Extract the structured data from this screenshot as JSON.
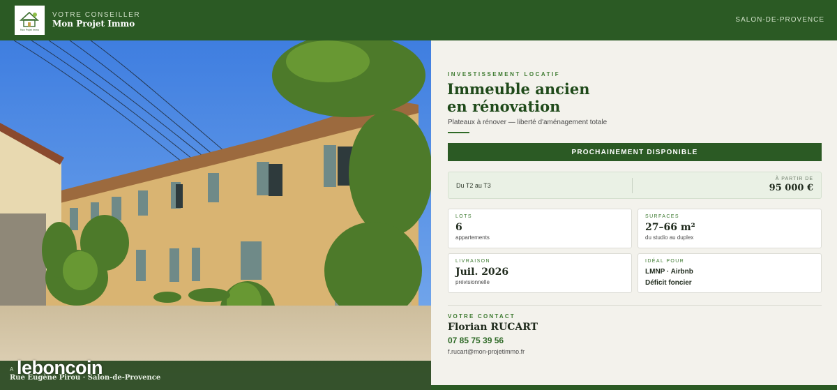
{
  "header": {
    "kicker": "VOTRE CONSEILLER",
    "brand": "Mon Projet Immo",
    "city": "SALON-DE-PROVENCE",
    "logo_text": "Mon Projet Immo"
  },
  "photo": {
    "address_kicker": "A",
    "address": "Rue Eugène Pirou · Salon-de-Provence",
    "watermark": "leboncoin"
  },
  "listing": {
    "kicker": "INVESTISSEMENT LOCATIF",
    "title_line1": "Immeuble ancien",
    "title_line2": "en rénovation",
    "subtitle": "Plateaux à rénover — liberté d'aménagement totale",
    "availability_label": "PROCHAINEMENT DISPONIBLE"
  },
  "price": {
    "range": "Du T2 au T3",
    "kicker": "À PARTIR DE",
    "value": "95 000 €"
  },
  "cards": {
    "lots": {
      "label": "LOTS",
      "value": "6",
      "sub": "appartements"
    },
    "surfaces": {
      "label": "SURFACES",
      "value": "27–66 m²",
      "sub": "du studio au duplex"
    },
    "livraison": {
      "label": "LIVRAISON",
      "value": "Juil. 2026",
      "sub": "prévisionnelle"
    },
    "ideal": {
      "label": "IDÉAL POUR",
      "line1": "LMNP · Airbnb",
      "line2": "Déficit foncier"
    }
  },
  "contact": {
    "kicker": "VOTRE CONTACT",
    "name": "Florian RUCART",
    "phone": "07 85 75 39 56",
    "email": "f.rucart@mon-projetimmo.fr"
  },
  "colors": {
    "brand_green": "#2b5a24",
    "accent_green": "#3d7a30",
    "panel_bg": "#f3f2ec"
  }
}
